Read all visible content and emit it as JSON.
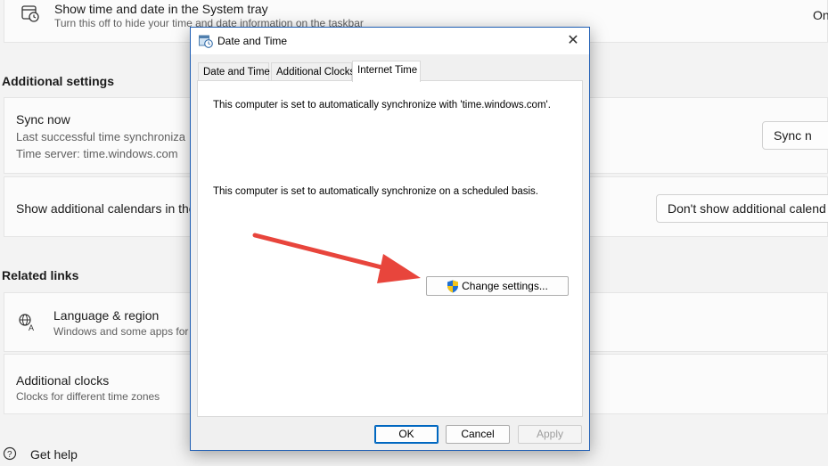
{
  "settings": {
    "tray_row": {
      "title": "Show time and date in the System tray",
      "subtitle": "Turn this off to hide your time and date information on the taskbar",
      "toggle_text": "On"
    },
    "additional_settings": {
      "heading": "Additional settings",
      "sync_title": "Sync now",
      "sync_last": "Last successful time synchroniza",
      "time_server": "Time server: time.windows.com",
      "sync_button": "Sync n"
    },
    "calendars_row": {
      "title": "Show additional calendars in the",
      "dropdown_value": "Don't show additional calend"
    },
    "related_links": {
      "heading": "Related links",
      "language_title": "Language & region",
      "language_sub": "Windows and some apps for",
      "clocks_title": "Additional clocks",
      "clocks_sub": "Clocks for different time zones"
    },
    "get_help": "Get help"
  },
  "dialog": {
    "title": "Date and Time",
    "tabs": [
      {
        "label": "Date and Time"
      },
      {
        "label": "Additional Clocks"
      },
      {
        "label": "Internet Time"
      }
    ],
    "active_tab": "Internet Time",
    "sync_text": "This computer is set to automatically synchronize with 'time.windows.com'.",
    "schedule_text": "This computer is set to automatically synchronize on a scheduled basis.",
    "change_button": "Change settings...",
    "ok": "OK",
    "cancel": "Cancel",
    "apply": "Apply"
  },
  "colors": {
    "annotation_arrow": "#e8453c",
    "accent": "#0067c0"
  }
}
